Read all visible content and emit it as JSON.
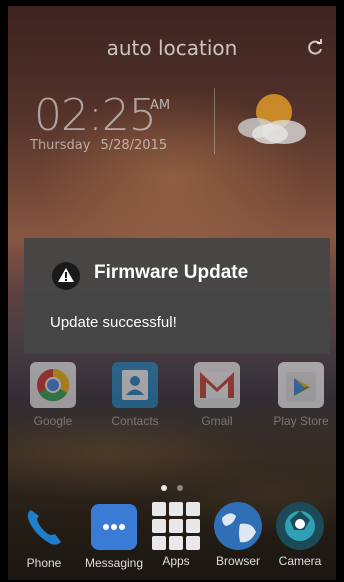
{
  "header": {
    "location": "auto location",
    "refresh_icon": "refresh-icon"
  },
  "clock": {
    "time": "02:25",
    "ampm": "AM",
    "day": "Thursday",
    "date": "5/28/2015",
    "weather_icon": "partly-cloudy-icon"
  },
  "dialog": {
    "icon": "warning-icon",
    "title": "Firmware Update",
    "message": "Update successful!"
  },
  "apps_row": [
    {
      "label": "Google",
      "icon": "google-icon"
    },
    {
      "label": "Contacts",
      "icon": "contacts-icon"
    },
    {
      "label": "Gmail",
      "icon": "gmail-icon"
    },
    {
      "label": "Play Store",
      "icon": "play-store-icon"
    }
  ],
  "dock": [
    {
      "label": "Phone",
      "icon": "phone-icon"
    },
    {
      "label": "Messaging",
      "icon": "messaging-icon"
    },
    {
      "label": "Apps",
      "icon": "apps-grid-icon"
    },
    {
      "label": "Browser",
      "icon": "browser-icon"
    },
    {
      "label": "Camera",
      "icon": "camera-icon"
    }
  ],
  "pager": {
    "pages": 2,
    "current": 1
  },
  "colors": {
    "dialog_bg": "#464646",
    "contacts_blue": "#1e88c8",
    "gmail_red": "#d23f31",
    "phone_blue": "#1e7ec8",
    "messaging_blue": "#3a7bd5"
  }
}
